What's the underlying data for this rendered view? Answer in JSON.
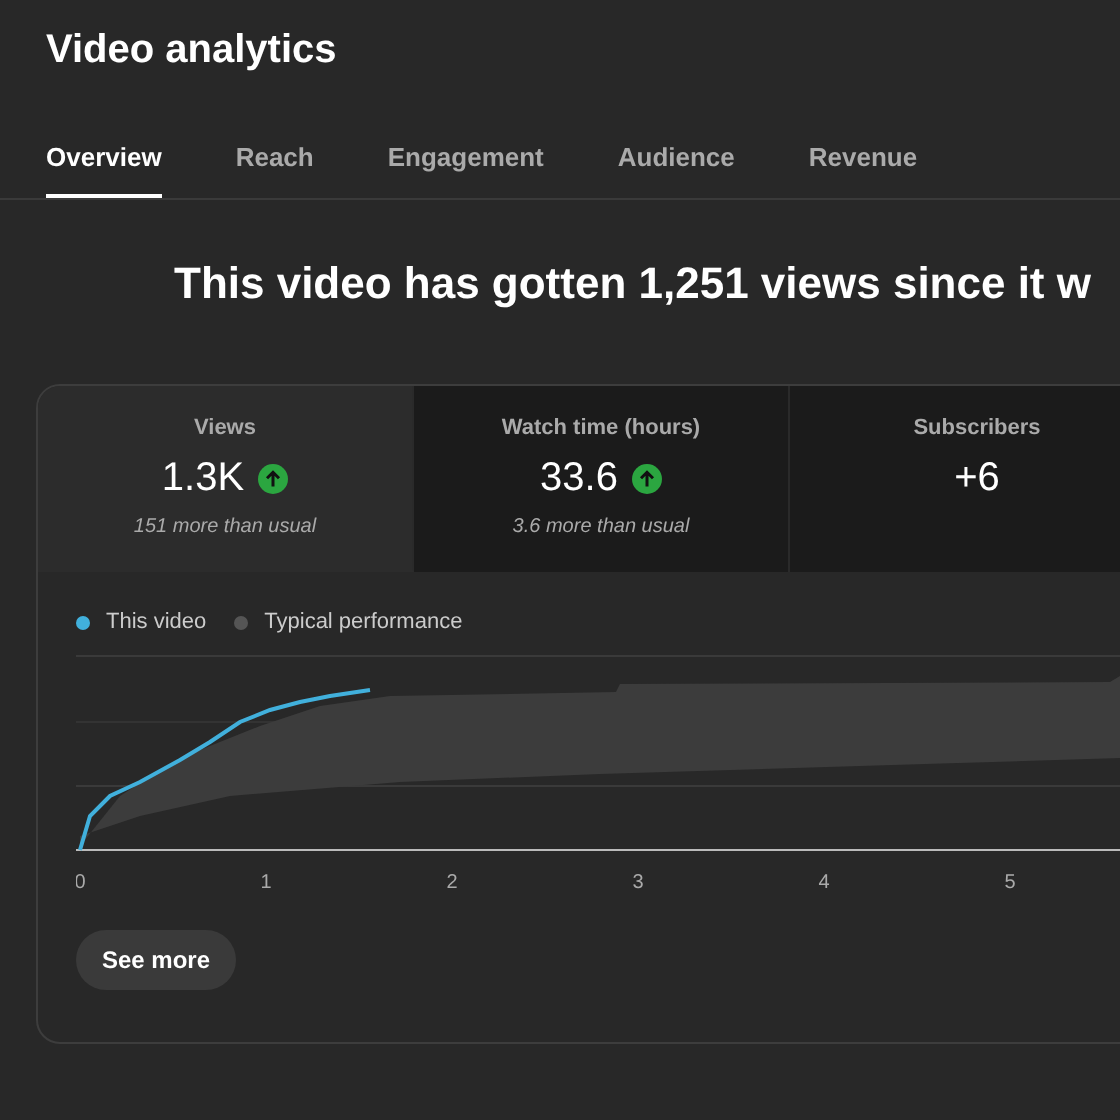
{
  "page": {
    "title": "Video analytics"
  },
  "tabs": [
    {
      "label": "Overview",
      "selected": true
    },
    {
      "label": "Reach",
      "selected": false
    },
    {
      "label": "Engagement",
      "selected": false
    },
    {
      "label": "Audience",
      "selected": false
    },
    {
      "label": "Revenue",
      "selected": false
    }
  ],
  "headline": "This video has gotten 1,251 views since it w",
  "metrics": [
    {
      "label": "Views",
      "value": "1.3K",
      "above_usual": true,
      "note": "151 more than usual",
      "selected": true
    },
    {
      "label": "Watch time (hours)",
      "value": "33.6",
      "above_usual": true,
      "note": "3.6 more than usual",
      "selected": false
    },
    {
      "label": "Subscribers",
      "value": "+6",
      "above_usual": false,
      "selected": false
    }
  ],
  "chart": {
    "legend": [
      {
        "kind": "line",
        "label": "This video",
        "color": "#41b0dc"
      },
      {
        "kind": "band",
        "label": "Typical performance",
        "color": "#555555"
      }
    ],
    "x_labels": [
      "0",
      "1",
      "2",
      "3",
      "4",
      "5"
    ]
  },
  "see_more": "See more"
}
